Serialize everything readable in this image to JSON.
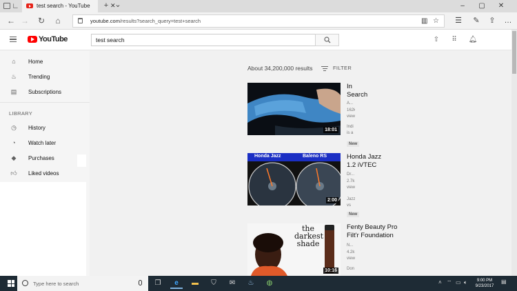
{
  "browser": {
    "tab_title": "test search - YouTube",
    "tab_close": "✕",
    "new_tab": "+",
    "tab_menu": "⌄",
    "url_host": "youtube.com",
    "url_path": "/results?search_query=test+search"
  },
  "youtube": {
    "logo_text": "YouTube",
    "search_value": "test search",
    "results_count": "About 34,200,000 results",
    "filter_label": "FILTER"
  },
  "sidebar": {
    "items": [
      {
        "label": "Home",
        "icon": "home-icon"
      },
      {
        "label": "Trending",
        "icon": "flame-icon"
      },
      {
        "label": "Subscriptions",
        "icon": "subscriptions-icon"
      }
    ],
    "library_header": "LIBRARY",
    "library_items": [
      {
        "label": "History",
        "icon": "history-icon"
      },
      {
        "label": "Watch later",
        "icon": "clock-icon"
      },
      {
        "label": "Purchases",
        "icon": "tag-icon"
      },
      {
        "label": "Liked videos",
        "icon": "thumbs-up-icon"
      }
    ]
  },
  "videos": [
    {
      "title": "In Search",
      "duration": "18:01",
      "meta1": "A...",
      "meta2": "162k",
      "meta3": "view",
      "desc1": "Indi",
      "desc2": "is a",
      "badge": "New"
    },
    {
      "title": "Honda Jazz 1.2 iVTEC",
      "duration": "2:00",
      "meta1": "Dr...",
      "meta2": "2.7k",
      "meta3": "view",
      "desc1": "Jazz",
      "desc2": "vs",
      "badge": "New",
      "thumb_left": "Honda Jazz",
      "thumb_right": "Baleno RS"
    },
    {
      "title": "Fenty Beauty Pro Filt'r Foundation",
      "duration": "10:16",
      "meta1": "N...",
      "meta2": "4.2k",
      "meta3": "view",
      "desc1": "Don",
      "desc2": "",
      "thumb_text1": "the",
      "thumb_text2": "darkest",
      "thumb_text3": "shade"
    }
  ],
  "taskbar": {
    "search_placeholder": "Type here to search",
    "time": "9:00 PM",
    "date": "9/23/2017"
  },
  "colors": {
    "youtube_red": "#ff0000",
    "taskbar_bg": "#1e2b35",
    "sidebar_bg": "#f5f5f5"
  }
}
